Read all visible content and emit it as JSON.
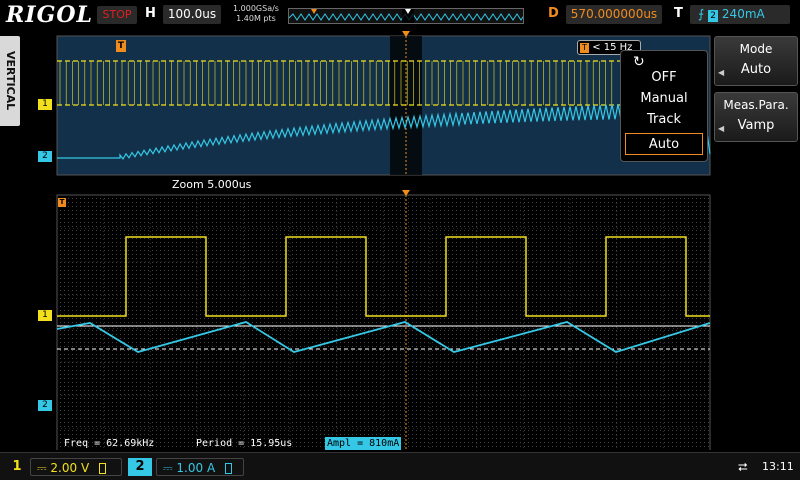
{
  "brand": "RIGOL",
  "top": {
    "run_state": "STOP",
    "h_label": "H",
    "timebase": "100.0us",
    "sample_rate": "1.000GSa/s",
    "memory_points": "1.40M pts",
    "d_label": "D",
    "delay": "570.000000us",
    "t_label": "T",
    "trigger_level": "240mA",
    "trigger_icon": "rising-edge-icon"
  },
  "left_tab": "VERTICAL",
  "overview": {
    "trigger_marker": "T",
    "popup_readout": "< 15 Hz",
    "ch1_marker": "1",
    "ch2_marker": "2"
  },
  "zoom": {
    "label": "Zoom  5.000us",
    "trigger_marker": "T",
    "ch1_marker": "1",
    "ch2_marker": "2"
  },
  "mode_popup": {
    "icon": "refresh-icon",
    "options": [
      "OFF",
      "Manual",
      "Track",
      "Auto"
    ],
    "selected": "Auto"
  },
  "menu": {
    "mode_title": "Mode",
    "mode_value": "Auto",
    "meas_title": "Meas.Para.",
    "meas_value": "Vamp"
  },
  "measurements": {
    "freq": "Freq = 62.69kHz",
    "period": "Period = 15.95us",
    "ampl": "Ampl = 810mA"
  },
  "bottom": {
    "ch1_badge": "1",
    "ch1_scale": "2.00 V",
    "ch2_badge": "2",
    "ch2_scale": "1.00 A",
    "time": "13:11"
  },
  "colors": {
    "ch1": "#f2e01e",
    "ch2": "#35c8e6",
    "accent": "#f08c1e",
    "overview_bg": "#123049"
  }
}
